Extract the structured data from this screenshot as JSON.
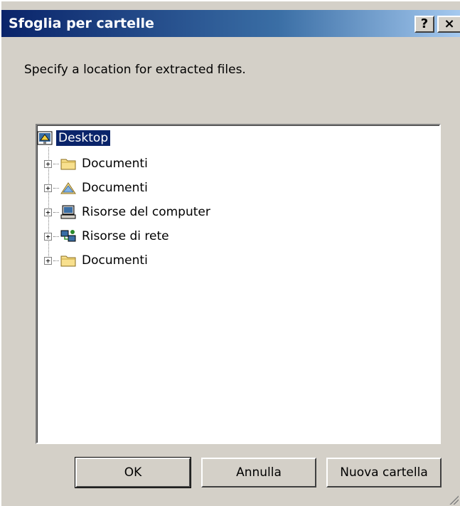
{
  "dialog": {
    "title": "Sfoglia per cartelle",
    "help_label": "?",
    "close_label": "×",
    "prompt": "Specify a location for extracted files."
  },
  "tree": {
    "root": {
      "label": "Desktop",
      "icon": "desktop-icon",
      "selected": true
    },
    "children": [
      {
        "label": "Documenti",
        "icon": "folder-icon"
      },
      {
        "label": "Documenti",
        "icon": "shared-documents-icon"
      },
      {
        "label": "Risorse del computer",
        "icon": "my-computer-icon"
      },
      {
        "label": "Risorse di rete",
        "icon": "network-places-icon"
      },
      {
        "label": "Documenti",
        "icon": "folder-icon"
      }
    ],
    "expander_symbol": "+"
  },
  "buttons": {
    "ok": "OK",
    "cancel": "Annulla",
    "new_folder": "Nuova cartella"
  },
  "colors": {
    "title_start": "#0a246a",
    "title_end": "#a6caf0",
    "face": "#d4d0c8",
    "selection": "#0a246a"
  }
}
